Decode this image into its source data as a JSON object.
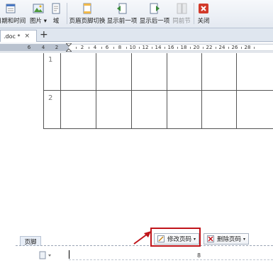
{
  "ribbon": {
    "buttons": [
      {
        "label": "日期和时间"
      },
      {
        "label": "图片",
        "dropdown": "▾"
      },
      {
        "label": "域"
      },
      {
        "label": "页眉页脚切换"
      },
      {
        "label": "显示前一项"
      },
      {
        "label": "显示后一项"
      },
      {
        "label": "同前节"
      },
      {
        "label": "关闭"
      }
    ]
  },
  "tabs": {
    "doc_tab": ".doc *",
    "close_glyph": "×",
    "new_tab_glyph": "+"
  },
  "ruler": {
    "ticks": [
      "6",
      "4",
      "2",
      "2",
      "4",
      "6",
      "8",
      "10",
      "12",
      "14",
      "16",
      "18",
      "20",
      "22",
      "24",
      "26",
      "28"
    ]
  },
  "table": {
    "row_numbers": [
      "1",
      "2"
    ]
  },
  "footer": {
    "label": "页脚",
    "modify_page_number": "修改页码",
    "delete_page_number": "删除页码",
    "dropdown_glyph": "▾",
    "page_number": "8"
  },
  "colors": {
    "highlight": "#c0141a",
    "ribbon_bg": "#e4e9f1"
  }
}
